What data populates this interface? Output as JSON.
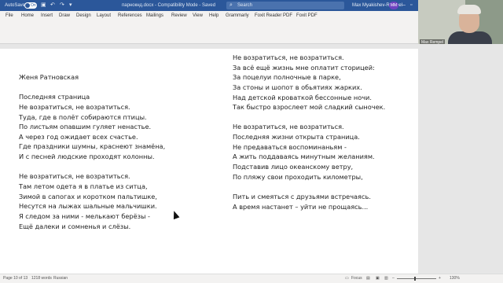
{
  "titlebar": {
    "autosave_label": "AutoSave",
    "autosave_state": "On",
    "doc_title": "парнокнд.docx - Compatibility Mode - Saved",
    "search_placeholder": "Search",
    "user_name": "Max Myakishev-Rempel",
    "user_initials": "MM",
    "accent_color": "#2b579a"
  },
  "ribbon": {
    "tabs": [
      "File",
      "Home",
      "Insert",
      "Draw",
      "Design",
      "Layout",
      "References",
      "Mailings",
      "Review",
      "View",
      "Help",
      "Grammarly",
      "Foxit Reader PDF",
      "Foxit PDF"
    ]
  },
  "webcam": {
    "participant_label": "Max Rempel"
  },
  "document": {
    "left_column": [
      "Женя Ратновская",
      "",
      "Последняя страница",
      "Не возратиться, не возратиться.",
      "Туда, где в полёт собираются птицы.",
      "По листьям опавшим гуляет ненастье.",
      "А через год ожидает всех счастье.",
      "Где праздники шумны, краснеют знамёна,",
      "И с песней людские проходят колонны.",
      "",
      "Не возратиться, не возратиться.",
      "Там летом одета я в платье из ситца,",
      "Зимой в сапогах и коротком пальтишке,",
      "Несутся на лыжах шальные мальчишки.",
      "Я следом за ними - мелькают берёзы -",
      "Ещё далеки и сомненья и слёзы."
    ],
    "right_column": [
      "Не возратиться, не возратиться.",
      "За всё ещё жизнь мне оплатит сторицей:",
      "За поцелуи полночные в парке,",
      "За стоны и шопот в обьятиях жарких.",
      "Над детской кроваткой бессонные ночи.",
      "Так быстро взрослеет мой сладкий сыночек.",
      "",
      "Не возратиться, не возратиться.",
      "Последняя жизни открыта страница.",
      "Не предаваться воспоминаньям -",
      "А жить поддаваясь минутным желаниям.",
      "Подставив лицо океанскому ветру,",
      "По пляжу свои проходить километры,",
      "",
      "Пить и смеяться с друзьями встречаясь.",
      "А время настанет – уйти не прощаясь..."
    ]
  },
  "statusbar": {
    "page_info": "Page 10 of 13",
    "word_count": "1218 words",
    "language": "Russian",
    "focus_label": "Focus",
    "zoom_label": "130%"
  }
}
